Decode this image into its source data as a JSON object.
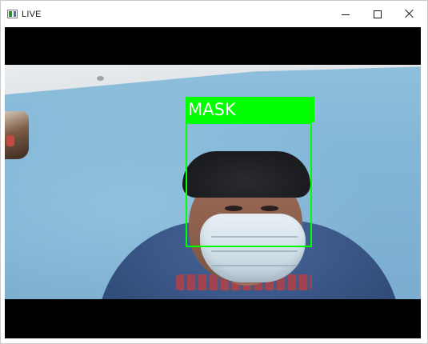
{
  "window": {
    "title": "LIVE",
    "icon": "app-window-icon",
    "controls": {
      "minimize_icon": "minimize-icon",
      "maximize_icon": "maximize-icon",
      "close_icon": "close-icon"
    }
  },
  "video": {
    "detection": {
      "label": "MASK",
      "box_color": "#00ff00",
      "label_color": "#ffffff"
    },
    "letterbox_color": "#000000"
  }
}
